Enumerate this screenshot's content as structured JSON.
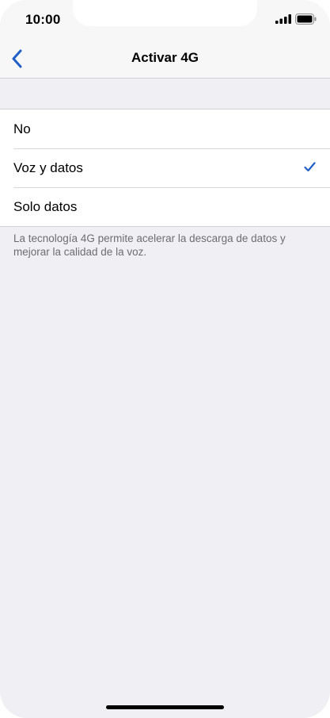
{
  "status_bar": {
    "time": "10:00",
    "icons": [
      "signal-icon",
      "battery-icon"
    ]
  },
  "nav": {
    "back_icon": "chevron-left-icon",
    "title": "Activar 4G"
  },
  "options": [
    {
      "label": "No",
      "selected": false
    },
    {
      "label": "Voz y datos",
      "selected": true
    },
    {
      "label": "Solo datos",
      "selected": false
    }
  ],
  "footer": {
    "text": "La tecnología 4G permite acelerar la descarga de datos y mejorar la calidad de la voz."
  },
  "colors": {
    "accent": "#1f5fc7",
    "background": "#efeff4",
    "secondary_text": "#6d6d72"
  }
}
